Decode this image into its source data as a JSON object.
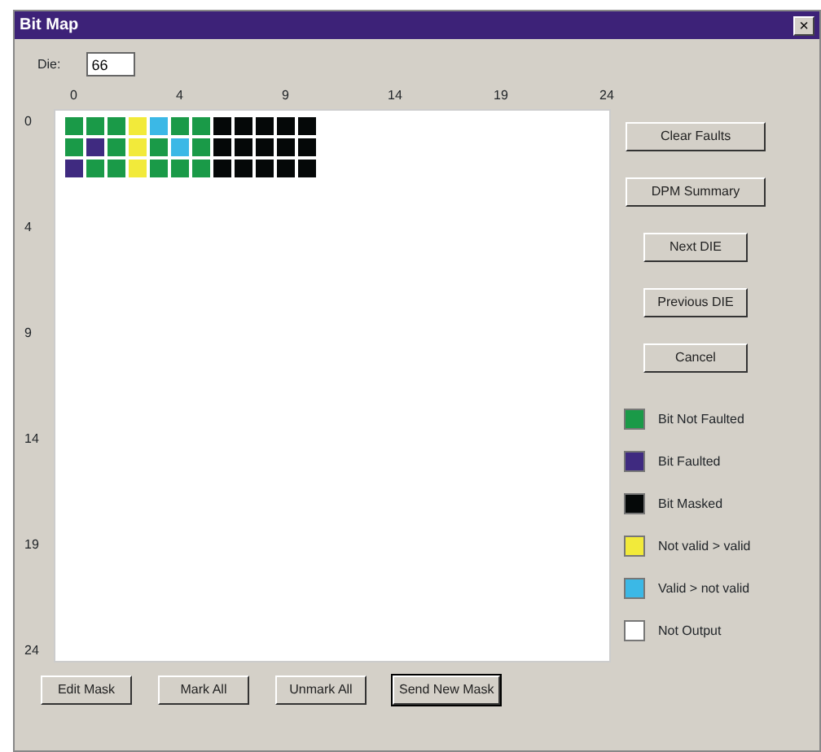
{
  "window": {
    "title": "Bit Map",
    "close": "×"
  },
  "die": {
    "label": "Die:",
    "value": "66"
  },
  "x_ticks": [
    "0",
    "4",
    "9",
    "14",
    "19",
    "24"
  ],
  "y_ticks": [
    "0",
    "4",
    "9",
    "14",
    "19",
    "24"
  ],
  "legend": [
    {
      "kind": "ok",
      "color": "#1a9a48",
      "label": "Bit Not Faulted"
    },
    {
      "kind": "fault",
      "color": "#3f2a80",
      "label": "Bit Faulted"
    },
    {
      "kind": "masked",
      "color": "#050808",
      "label": "Bit Masked"
    },
    {
      "kind": "nv2v",
      "color": "#f2ea3a",
      "label": "Not valid > valid"
    },
    {
      "kind": "v2nv",
      "color": "#3bb8e6",
      "label": "Valid > not valid"
    },
    {
      "kind": "none",
      "color": "#ffffff",
      "label": "Not Output"
    }
  ],
  "rows": [
    [
      {
        "kind": "ok"
      },
      {
        "kind": "ok"
      },
      {
        "kind": "ok"
      },
      {
        "kind": "nv2v"
      },
      {
        "kind": "v2nv"
      },
      {
        "kind": "ok"
      },
      {
        "kind": "ok"
      },
      {
        "kind": "masked"
      },
      {
        "kind": "masked"
      },
      {
        "kind": "masked"
      },
      {
        "kind": "masked"
      },
      {
        "kind": "masked"
      }
    ],
    [
      {
        "kind": "ok"
      },
      {
        "kind": "fault"
      },
      {
        "kind": "ok"
      },
      {
        "kind": "nv2v"
      },
      {
        "kind": "ok"
      },
      {
        "kind": "v2nv"
      },
      {
        "kind": "ok"
      },
      {
        "kind": "masked"
      },
      {
        "kind": "masked"
      },
      {
        "kind": "masked"
      },
      {
        "kind": "masked"
      },
      {
        "kind": "masked"
      }
    ],
    [
      {
        "kind": "fault"
      },
      {
        "kind": "ok"
      },
      {
        "kind": "ok"
      },
      {
        "kind": "nv2v"
      },
      {
        "kind": "ok"
      },
      {
        "kind": "ok"
      },
      {
        "kind": "ok"
      },
      {
        "kind": "masked"
      },
      {
        "kind": "masked"
      },
      {
        "kind": "masked"
      },
      {
        "kind": "masked"
      },
      {
        "kind": "masked"
      }
    ]
  ],
  "side_buttons": [
    "Clear Faults",
    "DPM Summary",
    "Next DIE",
    "Previous DIE",
    "Cancel"
  ],
  "bottom_buttons": [
    {
      "label": "Edit Mask",
      "selected": false
    },
    {
      "label": "Mark All",
      "selected": false
    },
    {
      "label": "Unmark All",
      "selected": false
    },
    {
      "label": "Send New Mask",
      "selected": true
    }
  ]
}
